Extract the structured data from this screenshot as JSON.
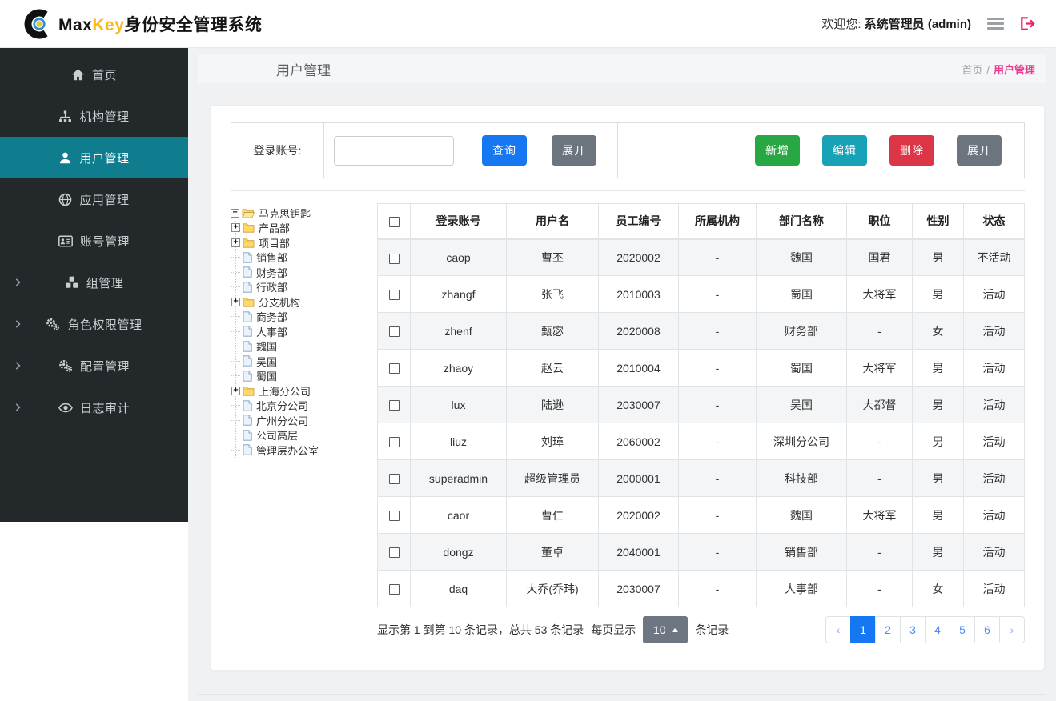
{
  "header": {
    "brand_max": "Max",
    "brand_key": "Key",
    "brand_suffix": "身份安全管理系统",
    "welcome_prefix": "欢迎您:",
    "welcome_user": "系统管理员 (admin)"
  },
  "sidebar": {
    "items": [
      {
        "id": "home",
        "label": "首页",
        "icon": "home-icon",
        "active": false,
        "expandable": false
      },
      {
        "id": "org",
        "label": "机构管理",
        "icon": "sitemap-icon",
        "active": false,
        "expandable": false
      },
      {
        "id": "user",
        "label": "用户管理",
        "icon": "user-icon",
        "active": true,
        "expandable": false
      },
      {
        "id": "app",
        "label": "应用管理",
        "icon": "globe-icon",
        "active": false,
        "expandable": false
      },
      {
        "id": "account",
        "label": "账号管理",
        "icon": "idcard-icon",
        "active": false,
        "expandable": false
      },
      {
        "id": "group",
        "label": "组管理",
        "icon": "cubes-icon",
        "active": false,
        "expandable": true
      },
      {
        "id": "role",
        "label": "角色权限管理",
        "icon": "gears-icon",
        "active": false,
        "expandable": true
      },
      {
        "id": "config",
        "label": "配置管理",
        "icon": "gears-icon",
        "active": false,
        "expandable": true
      },
      {
        "id": "audit",
        "label": "日志审计",
        "icon": "eye-icon",
        "active": false,
        "expandable": true
      }
    ]
  },
  "page": {
    "title": "用户管理",
    "breadcrumb_home": "首页",
    "breadcrumb_sep": "/",
    "breadcrumb_current": "用户管理"
  },
  "search": {
    "label": "登录账号:",
    "input_value": "",
    "query_label": "查询",
    "expand_label": "展开"
  },
  "actions": {
    "add": "新增",
    "edit": "编辑",
    "delete": "删除",
    "expand": "展开"
  },
  "tree": {
    "nodes": [
      {
        "label": "马克思钥匙",
        "level": 0,
        "type": "folder_open",
        "expander": "minus"
      },
      {
        "label": "产品部",
        "level": 1,
        "type": "folder",
        "expander": "plus"
      },
      {
        "label": "项目部",
        "level": 1,
        "type": "folder",
        "expander": "plus"
      },
      {
        "label": "销售部",
        "level": 1,
        "type": "file",
        "expander": "none"
      },
      {
        "label": "财务部",
        "level": 1,
        "type": "file",
        "expander": "none"
      },
      {
        "label": "行政部",
        "level": 1,
        "type": "file",
        "expander": "none"
      },
      {
        "label": "分支机构",
        "level": 1,
        "type": "folder",
        "expander": "plus"
      },
      {
        "label": "商务部",
        "level": 1,
        "type": "file",
        "expander": "none"
      },
      {
        "label": "人事部",
        "level": 1,
        "type": "file",
        "expander": "none"
      },
      {
        "label": "魏国",
        "level": 1,
        "type": "file",
        "expander": "none"
      },
      {
        "label": "吴国",
        "level": 1,
        "type": "file",
        "expander": "none"
      },
      {
        "label": "蜀国",
        "level": 1,
        "type": "file",
        "expander": "none"
      },
      {
        "label": "上海分公司",
        "level": 1,
        "type": "folder",
        "expander": "plus"
      },
      {
        "label": "北京分公司",
        "level": 1,
        "type": "file",
        "expander": "none"
      },
      {
        "label": "广州分公司",
        "level": 1,
        "type": "file",
        "expander": "none"
      },
      {
        "label": "公司高层",
        "level": 1,
        "type": "file",
        "expander": "none"
      },
      {
        "label": "管理层办公室",
        "level": 1,
        "type": "file",
        "expander": "none"
      }
    ]
  },
  "table": {
    "columns": [
      "登录账号",
      "用户名",
      "员工编号",
      "所属机构",
      "部门名称",
      "职位",
      "性别",
      "状态"
    ],
    "rows": [
      [
        "caop",
        "曹丕",
        "2020002",
        "-",
        "魏国",
        "国君",
        "男",
        "不活动"
      ],
      [
        "zhangf",
        "张飞",
        "2010003",
        "-",
        "蜀国",
        "大将军",
        "男",
        "活动"
      ],
      [
        "zhenf",
        "甄宓",
        "2020008",
        "-",
        "财务部",
        "-",
        "女",
        "活动"
      ],
      [
        "zhaoy",
        "赵云",
        "2010004",
        "-",
        "蜀国",
        "大将军",
        "男",
        "活动"
      ],
      [
        "lux",
        "陆逊",
        "2030007",
        "-",
        "吴国",
        "大都督",
        "男",
        "活动"
      ],
      [
        "liuz",
        "刘璋",
        "2060002",
        "-",
        "深圳分公司",
        "-",
        "男",
        "活动"
      ],
      [
        "superadmin",
        "超级管理员",
        "2000001",
        "-",
        "科技部",
        "-",
        "男",
        "活动"
      ],
      [
        "caor",
        "曹仁",
        "2020002",
        "-",
        "魏国",
        "大将军",
        "男",
        "活动"
      ],
      [
        "dongz",
        "董卓",
        "2040001",
        "-",
        "销售部",
        "-",
        "男",
        "活动"
      ],
      [
        "daq",
        "大乔(乔玮)",
        "2030007",
        "-",
        "人事部",
        "-",
        "女",
        "活动"
      ]
    ]
  },
  "pagination": {
    "info": "显示第 1 到第 10 条记录，总共 53 条记录",
    "per_page_label": "每页显示",
    "page_size": "10",
    "unit": "条记录",
    "prev": "‹",
    "next": "›",
    "pages": [
      "1",
      "2",
      "3",
      "4",
      "5",
      "6"
    ],
    "active_page": "1"
  },
  "colors": {
    "brand_yellow": "#fbb917",
    "primary_blue": "#1677f2",
    "add_green": "#28a745",
    "edit_teal": "#17a2b8",
    "delete_red": "#dc3545",
    "gray_button": "#6c757d",
    "sidebar_bg": "#23282b",
    "sidebar_active_teal": "#107d8f",
    "breadcrumb_pink": "#e83c8c",
    "logout_pink": "#ed2164"
  }
}
